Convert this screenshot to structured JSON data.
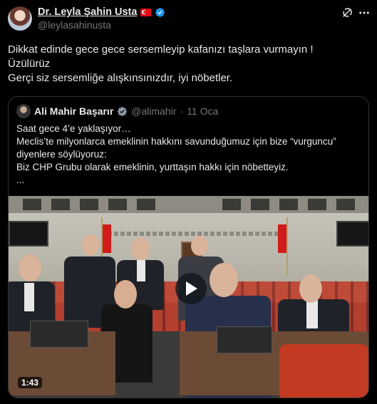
{
  "post": {
    "author": {
      "display_name": "Dr. Leyla Şahin Usta",
      "handle": "@leylasahinusta",
      "verified_color": "#1d9bf0",
      "flag_icon": "turkey-flag-icon"
    },
    "lines": [
      "Dikkat edinde gece gece sersemleyip kafanızı taşlara vurmayın !",
      "Üzülürüz",
      "Gerçi siz sersemliğe alışkınsınızdır, iyi nöbetler."
    ],
    "actions": {
      "grok_icon": "grok-icon",
      "more_icon": "more-icon"
    }
  },
  "quote": {
    "author": {
      "display_name": "Ali Mahir Başarır",
      "handle": "@alimahir",
      "separator": "·",
      "date": "11 Oca"
    },
    "lines": [
      "Saat gece 4’e yaklaşıyor…",
      "Meclis’te milyonlarca emeklinin hakkını savunduğumuz için bize “vurguncu”",
      "diyenlere söylüyoruz:",
      "Biz CHP Grubu olarak emeklinin, yurttaşın hakkı için nöbetteyiz.",
      "..."
    ],
    "video": {
      "duration": "1:43",
      "play_icon": "play-icon"
    }
  }
}
